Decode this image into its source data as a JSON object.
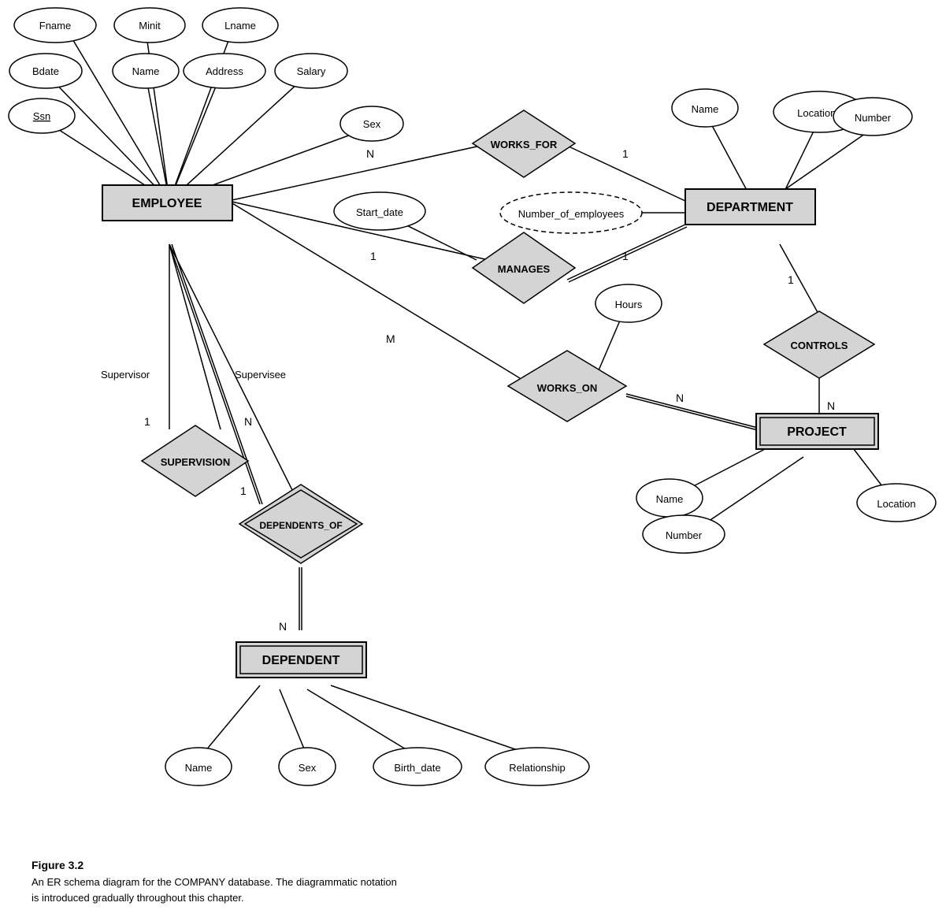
{
  "caption": {
    "title": "Figure 3.2",
    "text": "An ER schema diagram for the COMPANY database. The diagrammatic notation\nis introduced gradually throughout this chapter."
  },
  "entities": {
    "employee": "EMPLOYEE",
    "department": "DEPARTMENT",
    "project": "PROJECT",
    "dependent": "DEPENDENT"
  },
  "relationships": {
    "works_for": "WORKS_FOR",
    "manages": "MANAGES",
    "works_on": "WORKS_ON",
    "controls": "CONTROLS",
    "supervision": "SUPERVISION",
    "dependents_of": "DEPENDENTS_OF"
  },
  "attributes": {
    "fname": "Fname",
    "minit": "Minit",
    "lname": "Lname",
    "bdate": "Bdate",
    "name_emp": "Name",
    "address": "Address",
    "salary": "Salary",
    "ssn": "Ssn",
    "sex_emp": "Sex",
    "start_date": "Start_date",
    "num_employees": "Number_of_employees",
    "locations": "Locations",
    "dept_name": "Name",
    "dept_number": "Number",
    "hours": "Hours",
    "proj_name": "Name",
    "proj_number": "Number",
    "proj_location": "Location",
    "dep_name": "Name",
    "dep_sex": "Sex",
    "dep_birth": "Birth_date",
    "dep_rel": "Relationship"
  }
}
